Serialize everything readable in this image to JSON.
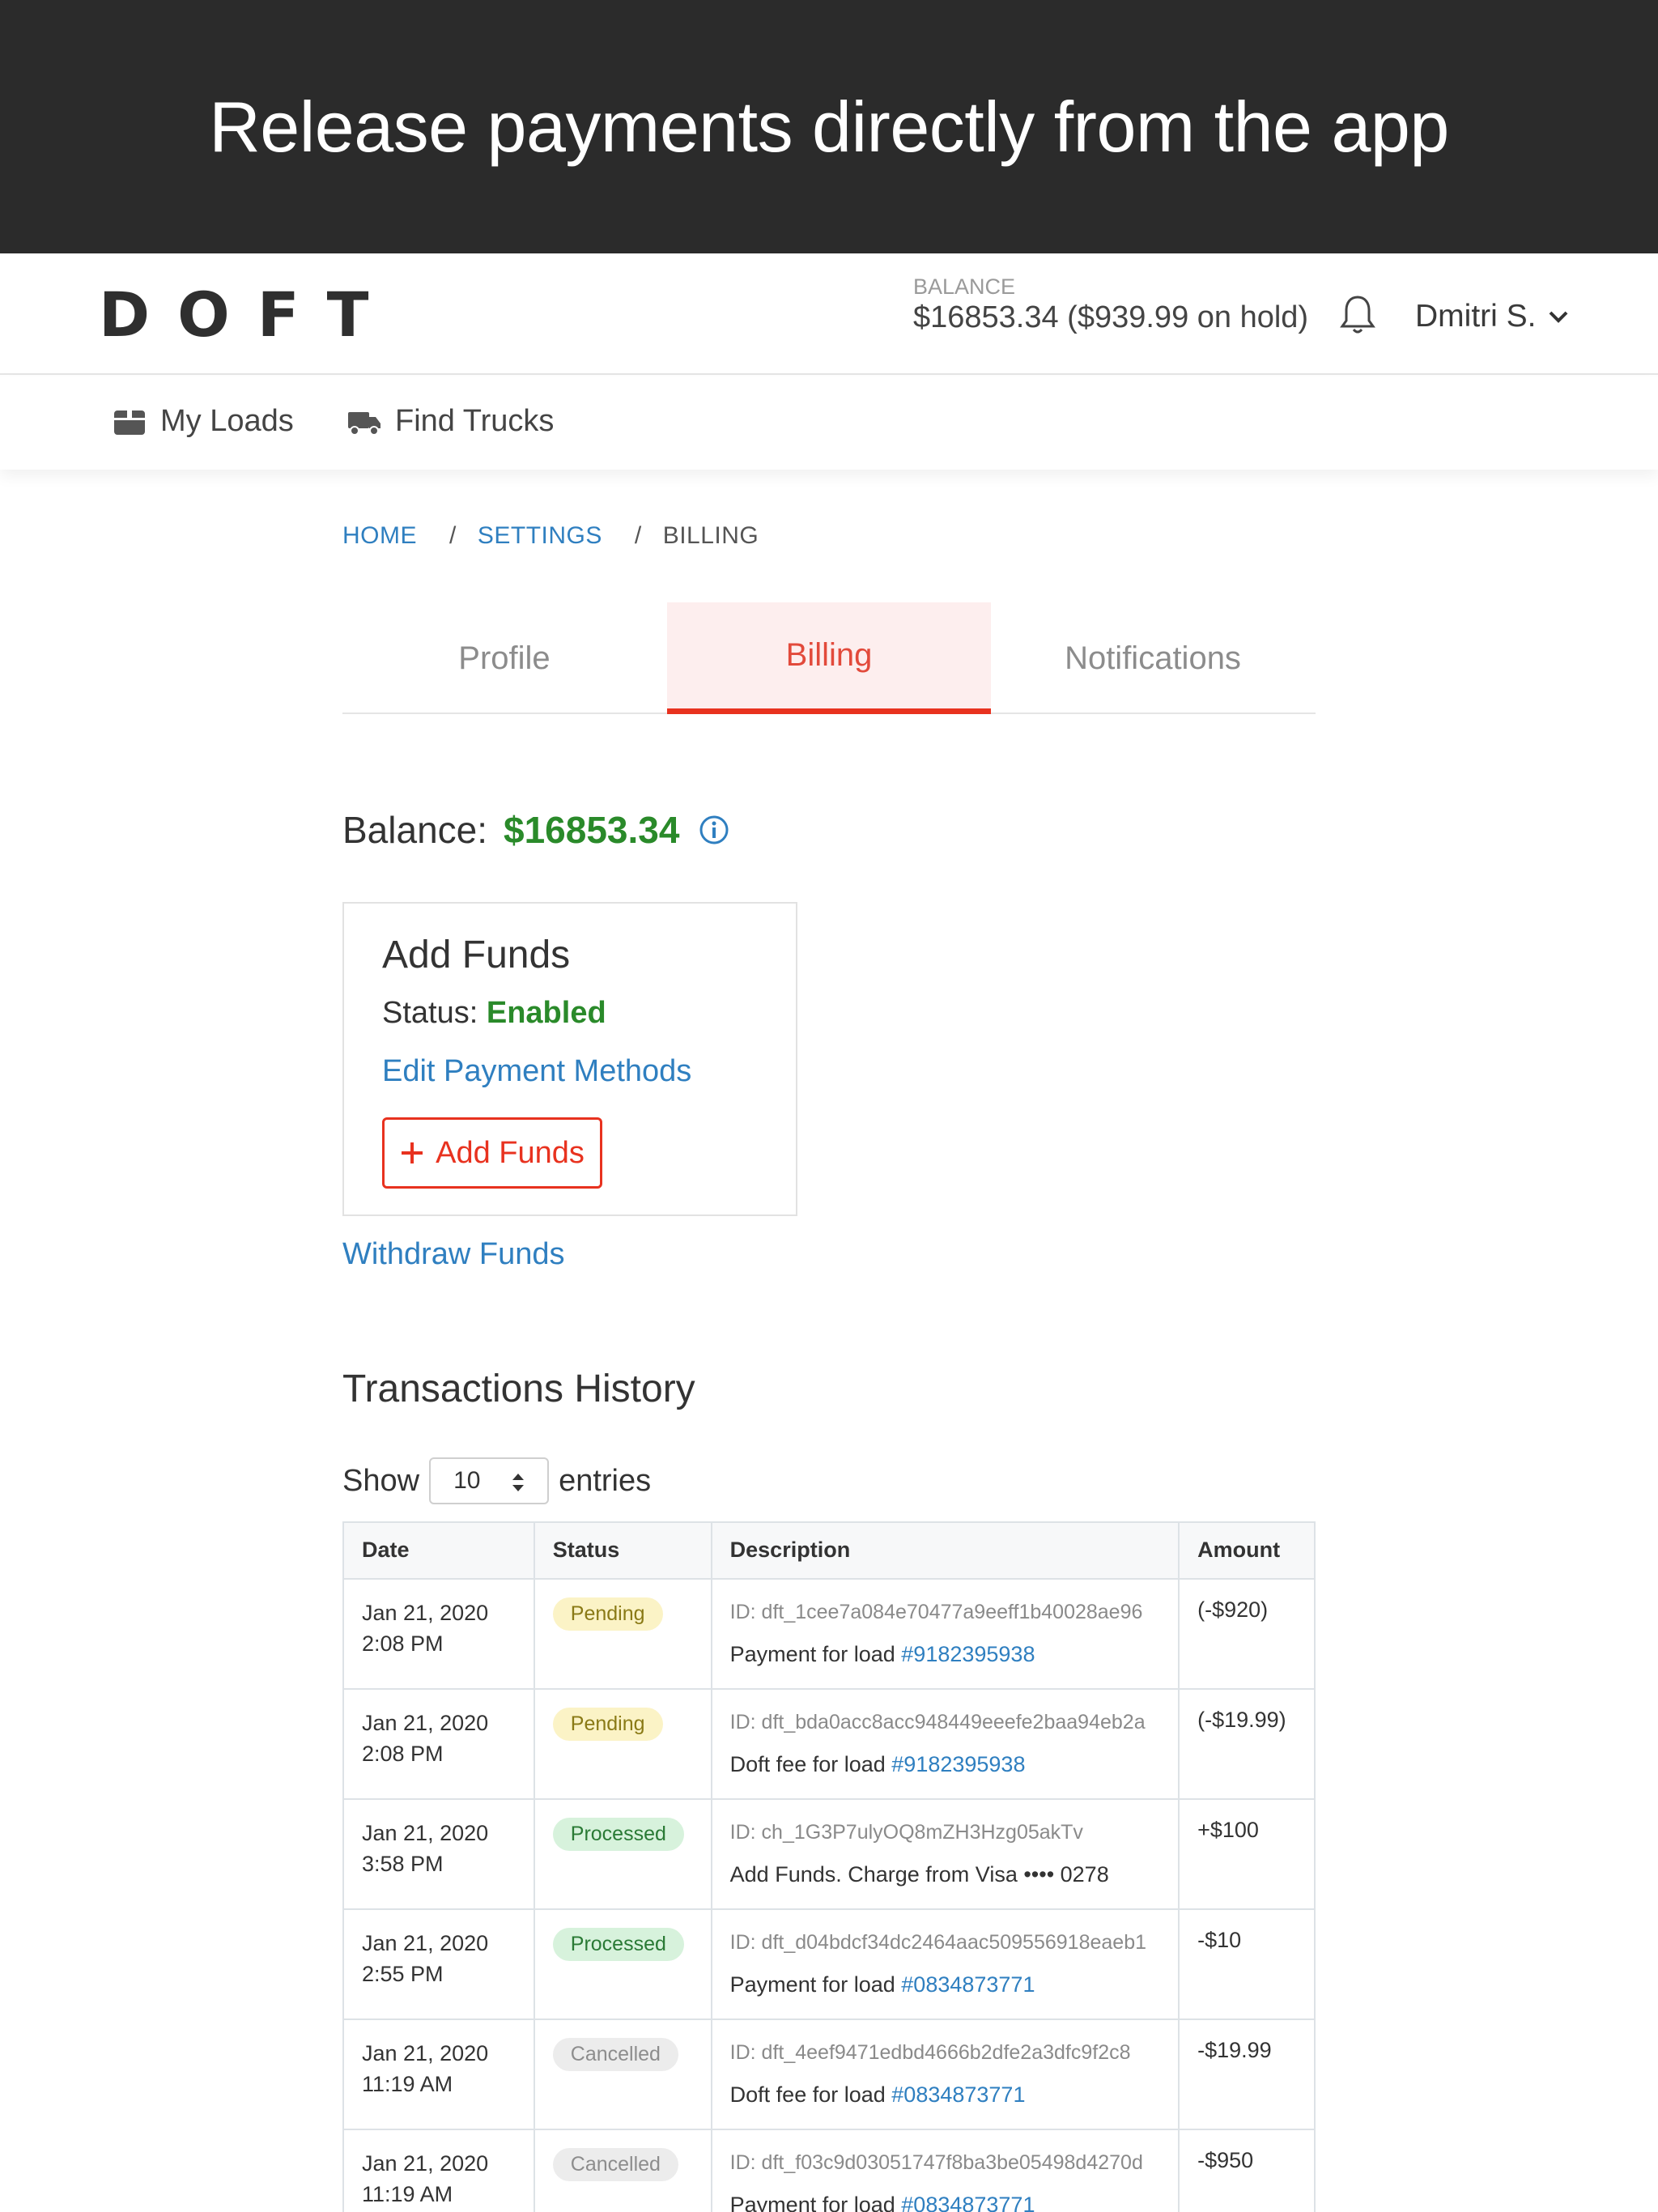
{
  "banner": {
    "headline": "Release payments directly from the app"
  },
  "header": {
    "logo_letters": [
      "D",
      "O",
      "F",
      "T"
    ],
    "balance_label": "BALANCE",
    "balance_value": "$16853.34 ($939.99 on hold)",
    "user_name": "Dmitri S."
  },
  "nav": {
    "my_loads": "My Loads",
    "find_trucks": "Find Trucks"
  },
  "breadcrumb": {
    "home": "HOME",
    "settings": "SETTINGS",
    "billing": "BILLING",
    "sep": "/"
  },
  "tabs": {
    "profile": "Profile",
    "billing": "Billing",
    "notifications": "Notifications"
  },
  "balance": {
    "label": "Balance:",
    "amount": "$16853.34"
  },
  "funds": {
    "title": "Add Funds",
    "status_label": "Status:",
    "status_value": "Enabled",
    "edit_link": "Edit Payment Methods",
    "add_button": "Add Funds",
    "withdraw_link": "Withdraw Funds"
  },
  "transactions": {
    "title": "Transactions History",
    "show_label": "Show",
    "entries_value": "10",
    "entries_label": "entries",
    "headers": {
      "date": "Date",
      "status": "Status",
      "description": "Description",
      "amount": "Amount"
    },
    "rows": [
      {
        "date": "Jan 21, 2020",
        "time": "2:08 PM",
        "status": "Pending",
        "id": "ID: dft_1cee7a084e70477a9eeff1b40028ae96",
        "desc": "Payment for load ",
        "link": "#9182395938",
        "amount": "(-$920)"
      },
      {
        "date": "Jan 21, 2020",
        "time": "2:08 PM",
        "status": "Pending",
        "id": "ID: dft_bda0acc8acc948449eeefe2baa94eb2a",
        "desc": "Doft fee for load ",
        "link": "#9182395938",
        "amount": "(-$19.99)"
      },
      {
        "date": "Jan 21, 2020",
        "time": "3:58 PM",
        "status": "Processed",
        "id": "ID: ch_1G3P7ulyOQ8mZH3Hzg05akTv",
        "desc": "Add Funds. Charge from Visa •••• 0278",
        "link": "",
        "amount": "+$100"
      },
      {
        "date": "Jan 21, 2020",
        "time": "2:55 PM",
        "status": "Processed",
        "id": "ID: dft_d04bdcf34dc2464aac509556918eaeb1",
        "desc": "Payment for load ",
        "link": "#0834873771",
        "amount": "-$10"
      },
      {
        "date": "Jan 21, 2020",
        "time": "11:19 AM",
        "status": "Cancelled",
        "id": "ID: dft_4eef9471edbd4666b2dfe2a3dfc9f2c8",
        "desc": "Doft fee for load ",
        "link": "#0834873771",
        "amount": "-$19.99"
      },
      {
        "date": "Jan 21, 2020",
        "time": "11:19 AM",
        "status": "Cancelled",
        "id": "ID: dft_f03c9d03051747f8ba3be05498d4270d",
        "desc": "Payment for load ",
        "link": "#0834873771",
        "amount": "-$950"
      }
    ]
  },
  "colors": {
    "banner_bg": "#2b2b2b",
    "accent_red": "#e8321f",
    "link_blue": "#2f7fc0",
    "success_green": "#2a8a2a"
  },
  "icons": {
    "bell": "bell-icon",
    "chevron": "chevron-down-icon",
    "box": "box-icon",
    "truck": "truck-icon",
    "info": "info-icon",
    "plus": "plus-icon",
    "sort": "sort-arrows-icon"
  }
}
